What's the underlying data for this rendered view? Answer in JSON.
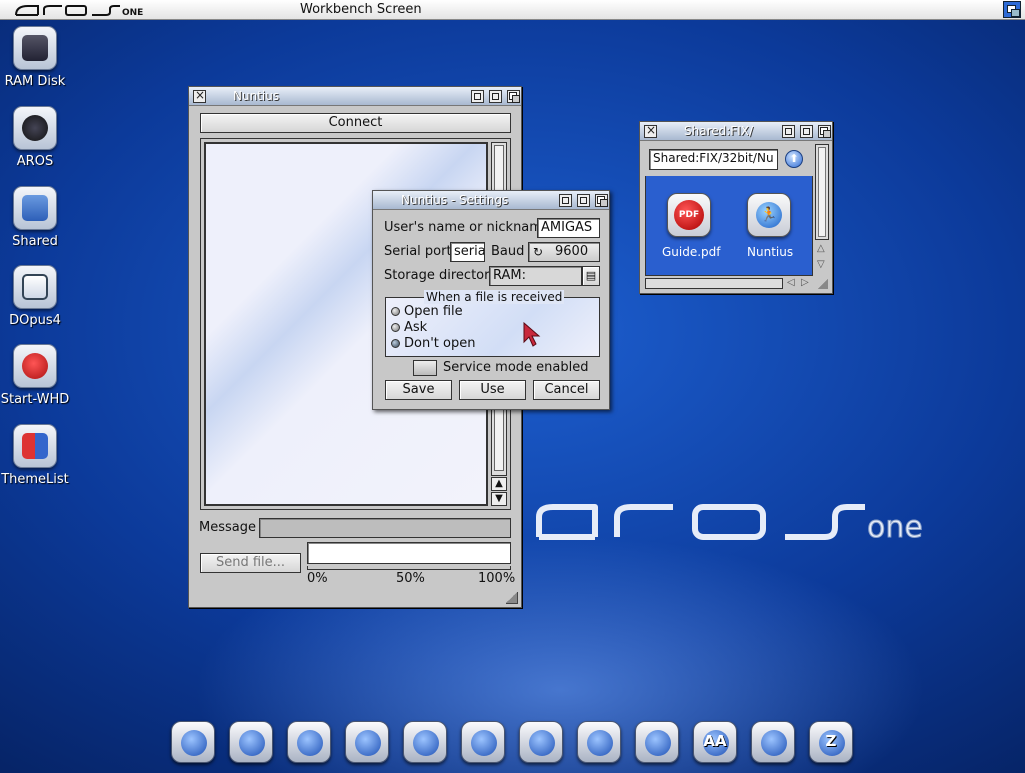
{
  "screen": {
    "logo_text": "arosone",
    "title": "Workbench Screen"
  },
  "desktop_icons": [
    {
      "label": "RAM Disk",
      "icon": "ram-disk-icon"
    },
    {
      "label": "AROS",
      "icon": "aros-drive-icon"
    },
    {
      "label": "Shared",
      "icon": "shared-drive-icon"
    },
    {
      "label": "DOpus4",
      "icon": "dopus-icon"
    },
    {
      "label": "Start-WHD",
      "icon": "whdload-icon"
    },
    {
      "label": "ThemeList",
      "icon": "themelist-icon"
    }
  ],
  "nuntius": {
    "title": "Nuntius",
    "connect_label": "Connect",
    "message_label": "Message",
    "message_value": "",
    "send_file_label": "Send file...",
    "progress": 0,
    "progress_ticks": [
      "0%",
      "50%",
      "100%"
    ]
  },
  "settings": {
    "title": "Nuntius - Settings",
    "nickname_label": "User's name or nickname",
    "nickname_value": "AMIGAS",
    "serial_label": "Serial port",
    "serial_value": "seria",
    "baud_label": "Baud",
    "baud_value": "9600",
    "storage_label": "Storage directory",
    "storage_value": "RAM:",
    "group_title": "When a file is received",
    "options": [
      {
        "label": "Open file",
        "selected": false
      },
      {
        "label": "Ask",
        "selected": false
      },
      {
        "label": "Don't open",
        "selected": true
      }
    ],
    "service_mode_label": "Service mode enabled",
    "service_mode_checked": false,
    "save_label": "Save",
    "use_label": "Use",
    "cancel_label": "Cancel"
  },
  "shared_window": {
    "title": "Shared:FIX/",
    "path_value": "Shared:FIX/32bit/Nu",
    "files": [
      {
        "label": "Guide.pdf",
        "icon": "pdf-icon",
        "badge": "PDF"
      },
      {
        "label": "Nuntius",
        "icon": "nuntius-runner-icon"
      }
    ]
  },
  "dock": [
    {
      "icon": "system-tools-icon"
    },
    {
      "icon": "network-icon"
    },
    {
      "icon": "display-prefs-icon"
    },
    {
      "icon": "calculator-icon"
    },
    {
      "icon": "pointer-prefs-icon"
    },
    {
      "icon": "clock-icon"
    },
    {
      "icon": "keyboard-icon"
    },
    {
      "icon": "screenmode-icon"
    },
    {
      "icon": "web-browser-icon"
    },
    {
      "icon": "fonts-icon",
      "text": "AA"
    },
    {
      "icon": "themes-icon"
    },
    {
      "icon": "zune-icon",
      "text": "Z"
    }
  ],
  "colors": {
    "desktop": "#0c3a9a",
    "window_bg": "#c8c8c8",
    "icon_area": "#2a5fcf"
  }
}
